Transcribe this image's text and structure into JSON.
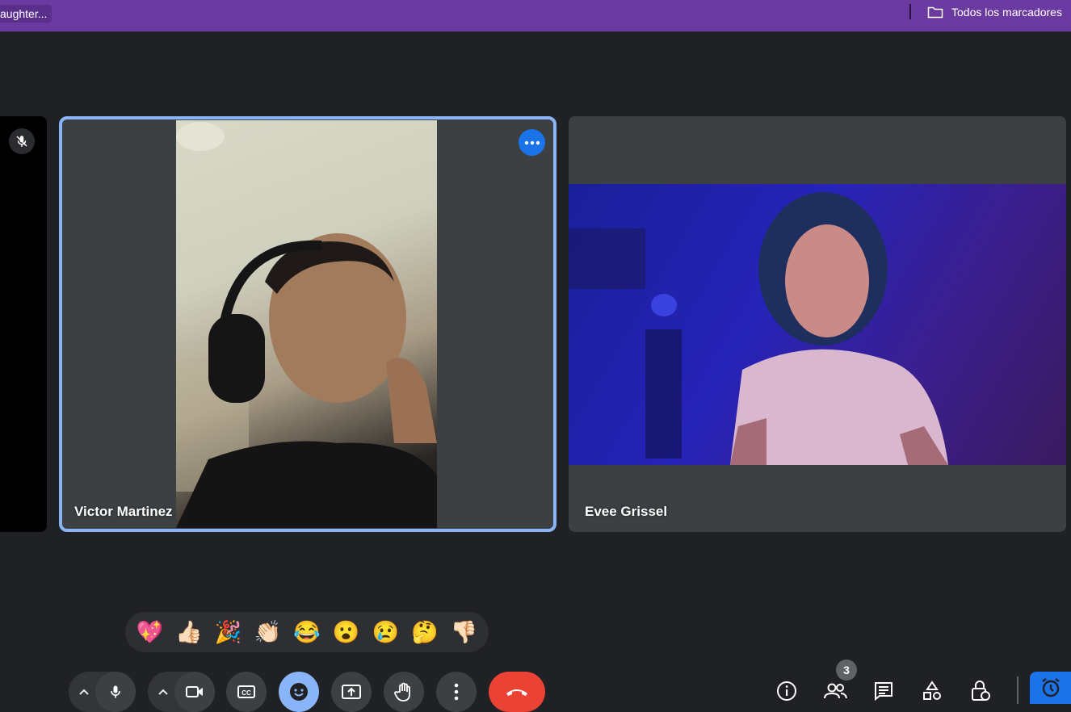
{
  "bookmarks_bar": {
    "left_item": "aughter...",
    "right_item": "Todos los marcadores",
    "folder_icon": "folder-icon"
  },
  "participants": [
    {
      "name": "Victor Martinez",
      "active_speaker": true
    },
    {
      "name": "Evee Grissel",
      "active_speaker": false
    }
  ],
  "reactions": [
    "💖",
    "👍🏻",
    "🎉",
    "👏🏻",
    "😂",
    "😮",
    "😢",
    "🤔",
    "👎🏻"
  ],
  "controls": {
    "participants_count": "3"
  },
  "colors": {
    "background": "#202124",
    "tile": "#3c4043",
    "accent": "#8ab4f8",
    "primary": "#1a73e8",
    "end_call": "#ea4335",
    "bookmarks_bar": "#6b3aa0"
  }
}
